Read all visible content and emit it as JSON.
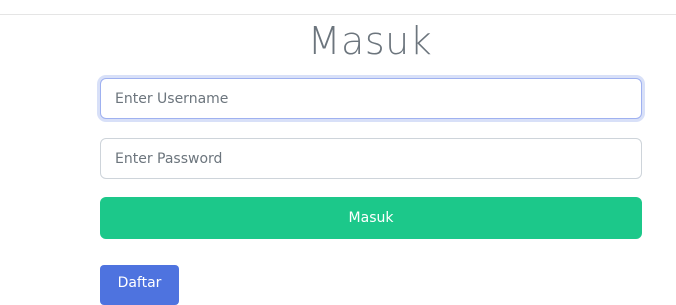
{
  "page": {
    "title": "Masuk"
  },
  "form": {
    "username": {
      "value": "",
      "placeholder": "Enter Username"
    },
    "password": {
      "value": "",
      "placeholder": "Enter Password"
    },
    "submit_label": "Masuk"
  },
  "register_label": "Daftar",
  "colors": {
    "submit_button": "#1cc88a",
    "register_button": "#4e73df",
    "title_text": "#6c757d",
    "focus_ring": "#9fb1f0"
  }
}
